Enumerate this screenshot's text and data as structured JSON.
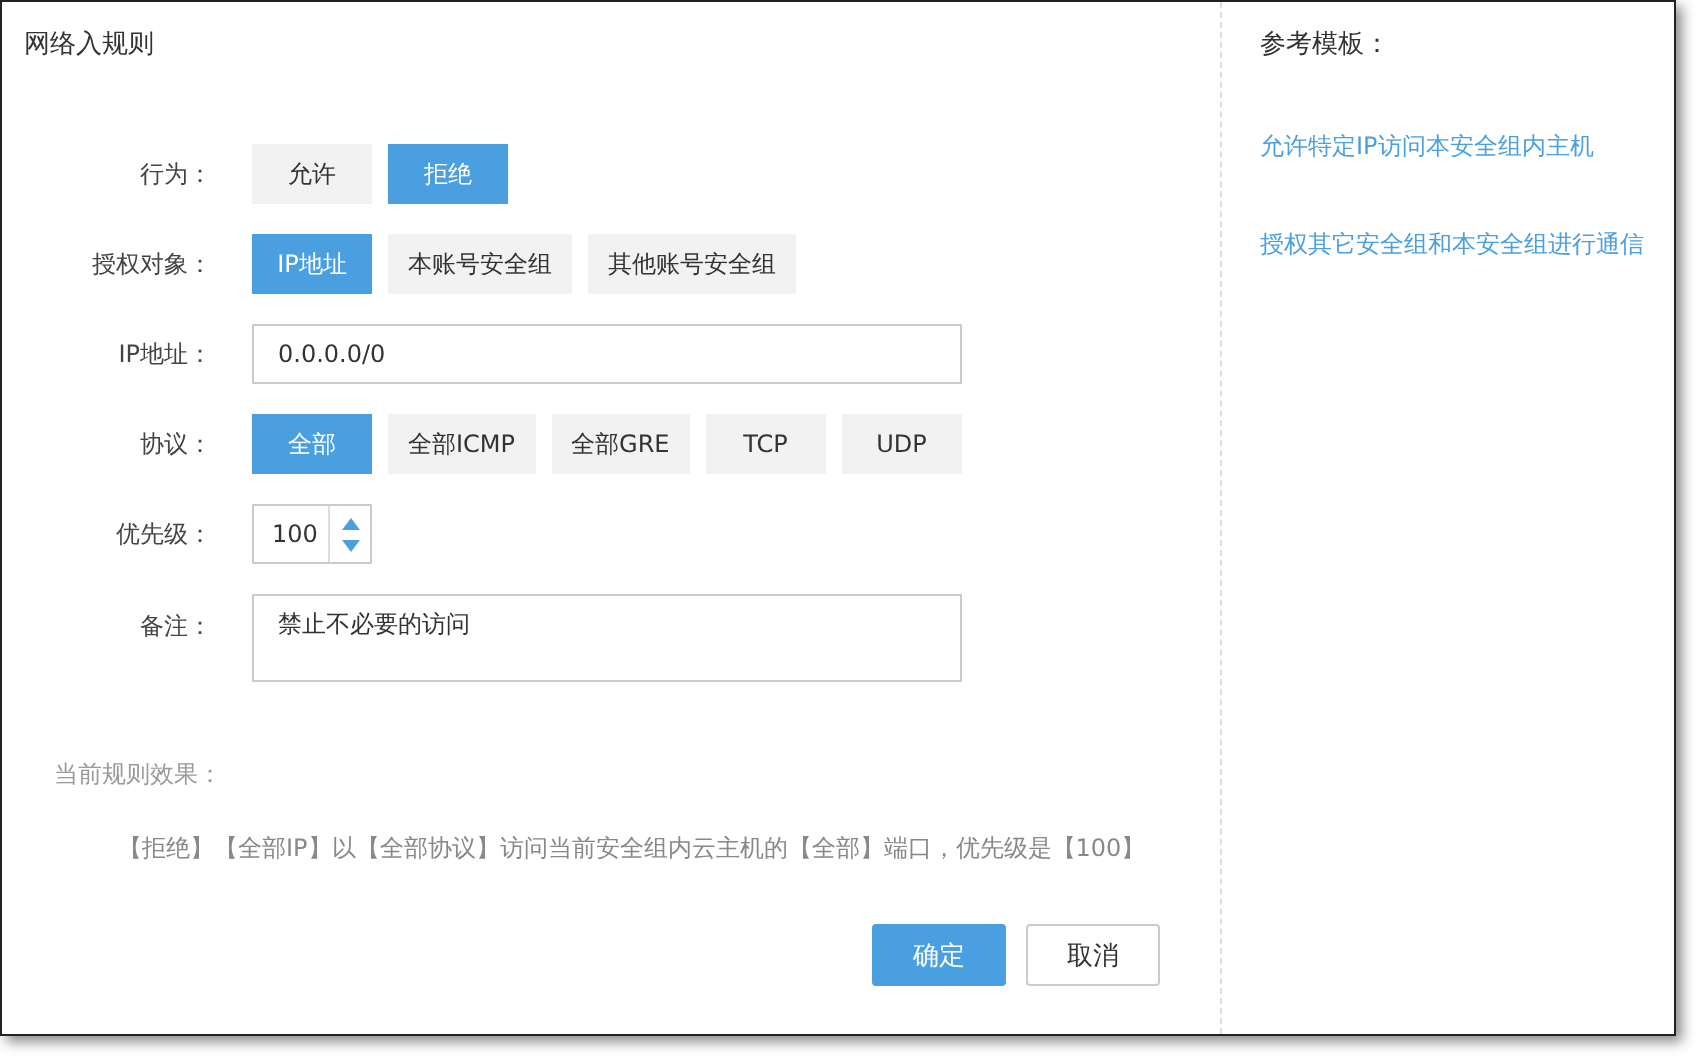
{
  "title": "网络入规则",
  "form": [
    {
      "kind": "choice",
      "label": "行为：",
      "options": [
        {
          "label": "允许",
          "selected": false
        },
        {
          "label": "拒绝",
          "selected": true
        }
      ]
    },
    {
      "kind": "choice",
      "label": "授权对象：",
      "options": [
        {
          "label": "IP地址",
          "selected": true
        },
        {
          "label": "本账号安全组",
          "selected": false
        },
        {
          "label": "其他账号安全组",
          "selected": false
        }
      ]
    },
    {
      "kind": "text",
      "label": "IP地址：",
      "value": "0.0.0.0/0"
    },
    {
      "kind": "choice",
      "label": "协议：",
      "options": [
        {
          "label": "全部",
          "selected": true
        },
        {
          "label": "全部ICMP",
          "selected": false
        },
        {
          "label": "全部GRE",
          "selected": false
        },
        {
          "label": "TCP",
          "selected": false
        },
        {
          "label": "UDP",
          "selected": false
        }
      ]
    },
    {
      "kind": "number",
      "label": "优先级：",
      "value": "100"
    },
    {
      "kind": "textarea",
      "label": "备注：",
      "value": "禁止不必要的访问"
    }
  ],
  "effect": {
    "label": "当前规则效果：",
    "text": "【拒绝】【全部IP】以【全部协议】访问当前安全组内云主机的【全部】端口，优先级是【100】"
  },
  "buttons": [
    {
      "label": "确定",
      "kind": "primary"
    },
    {
      "label": "取消",
      "kind": "default"
    }
  ],
  "templates": {
    "title": "参考模板：",
    "links": [
      "允许特定IP访问本安全组内主机",
      "授权其它安全组和本安全组进行通信"
    ]
  }
}
